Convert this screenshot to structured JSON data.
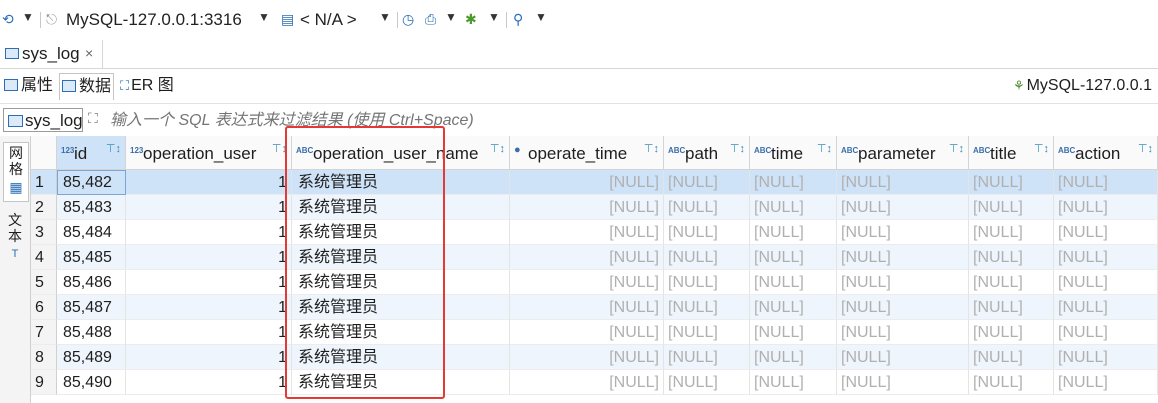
{
  "toolbar": {
    "connection": "MySQL-127.0.0.1:3316",
    "schema": "< N/A >"
  },
  "document_tab": {
    "label": "sys_log",
    "close": "×"
  },
  "subtabs": [
    {
      "label": "属性"
    },
    {
      "label": "数据"
    },
    {
      "label": "ER 图"
    }
  ],
  "connection_right": "MySQL-127.0.0.1",
  "filter": {
    "table": "sys_log",
    "placeholder": "输入一个 SQL 表达式来过滤结果 (使用 Ctrl+Space)"
  },
  "side_tabs": {
    "grid": "网格",
    "text": "文本"
  },
  "columns": [
    {
      "type": "123",
      "name": "id"
    },
    {
      "type": "123",
      "name": "operation_user"
    },
    {
      "type": "ABC",
      "name": "operation_user_name"
    },
    {
      "type": "clock",
      "name": "operate_time"
    },
    {
      "type": "ABC",
      "name": "path"
    },
    {
      "type": "ABC",
      "name": "time"
    },
    {
      "type": "ABC",
      "name": "parameter"
    },
    {
      "type": "ABC",
      "name": "title"
    },
    {
      "type": "ABC",
      "name": "action"
    }
  ],
  "rows": [
    {
      "n": "1",
      "id": "85,482",
      "operation_user": "1",
      "operation_user_name": "系统管理员"
    },
    {
      "n": "2",
      "id": "85,483",
      "operation_user": "1",
      "operation_user_name": "系统管理员"
    },
    {
      "n": "3",
      "id": "85,484",
      "operation_user": "1",
      "operation_user_name": "系统管理员"
    },
    {
      "n": "4",
      "id": "85,485",
      "operation_user": "1",
      "operation_user_name": "系统管理员"
    },
    {
      "n": "5",
      "id": "85,486",
      "operation_user": "1",
      "operation_user_name": "系统管理员"
    },
    {
      "n": "6",
      "id": "85,487",
      "operation_user": "1",
      "operation_user_name": "系统管理员"
    },
    {
      "n": "7",
      "id": "85,488",
      "operation_user": "1",
      "operation_user_name": "系统管理员"
    },
    {
      "n": "8",
      "id": "85,489",
      "operation_user": "1",
      "operation_user_name": "系统管理员"
    },
    {
      "n": "9",
      "id": "85,490",
      "operation_user": "1",
      "operation_user_name": "系统管理员"
    }
  ],
  "null_text": "[NULL]",
  "colors": {
    "selected_row": "#cfe3f8",
    "alt_row": "#eef5fc",
    "highlight": "#e53935"
  }
}
